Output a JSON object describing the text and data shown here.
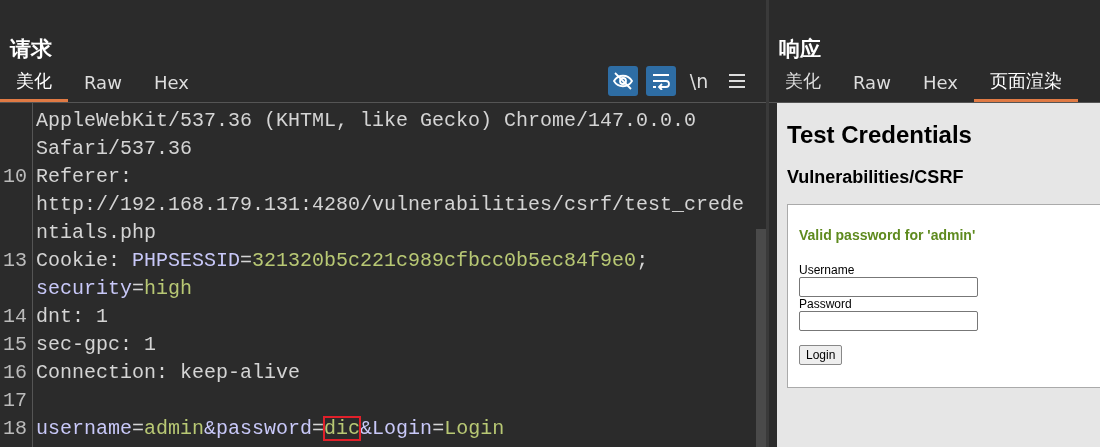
{
  "request": {
    "title": "请求",
    "tabs": [
      {
        "label": "美化",
        "selected": true
      },
      {
        "label": "Raw",
        "selected": false
      },
      {
        "label": "Hex",
        "selected": false
      }
    ],
    "toolbar": [
      {
        "kind": "eye-slash",
        "on": true
      },
      {
        "kind": "wrap",
        "on": true
      },
      {
        "kind": "text",
        "label": "\\n",
        "on": false
      },
      {
        "kind": "menu",
        "on": false
      }
    ],
    "lines": [
      {
        "tokens": [
          {
            "kind": "plain",
            "text": "AppleWebKit/537.36 (KHTML, like Gecko) Chrome/147.0.0.0"
          }
        ]
      },
      {
        "tokens": [
          {
            "kind": "plain",
            "text": "Safari/537.36"
          }
        ]
      },
      {
        "number": "10",
        "tokens": [
          {
            "kind": "plain",
            "text": "Referer:"
          }
        ]
      },
      {
        "tokens": [
          {
            "kind": "plain",
            "text": "http://192.168.179.131:4280/vulnerabilities/csrf/test_crede"
          }
        ]
      },
      {
        "tokens": [
          {
            "kind": "plain",
            "text": "ntials.php"
          }
        ]
      },
      {
        "number": "13",
        "tokens": [
          {
            "kind": "plain",
            "text": "Cookie: "
          },
          {
            "kind": "key",
            "text": "PHPSESSID"
          },
          {
            "kind": "plain",
            "text": "="
          },
          {
            "kind": "value",
            "text": "321320b5c221c989cfbcc0b5ec84f9e0"
          },
          {
            "kind": "plain",
            "text": ";"
          }
        ]
      },
      {
        "tokens": [
          {
            "kind": "key",
            "text": "security"
          },
          {
            "kind": "plain",
            "text": "="
          },
          {
            "kind": "value",
            "text": "high"
          }
        ]
      },
      {
        "number": "14",
        "tokens": [
          {
            "kind": "plain",
            "text": "dnt: 1"
          }
        ]
      },
      {
        "number": "15",
        "tokens": [
          {
            "kind": "plain",
            "text": "sec-gpc: 1"
          }
        ]
      },
      {
        "number": "16",
        "tokens": [
          {
            "kind": "plain",
            "text": "Connection: keep-alive"
          }
        ]
      },
      {
        "number": "17"
      },
      {
        "number": "18",
        "tokens": [
          {
            "kind": "key",
            "text": "username"
          },
          {
            "kind": "plain",
            "text": "="
          },
          {
            "kind": "value",
            "text": "admin"
          },
          {
            "kind": "key",
            "text": "&password"
          },
          {
            "kind": "plain",
            "text": "="
          },
          {
            "kind": "value",
            "text": "dic",
            "highlighted": true
          },
          {
            "kind": "key",
            "text": "&Login"
          },
          {
            "kind": "plain",
            "text": "="
          },
          {
            "kind": "value",
            "text": "Login"
          }
        ]
      }
    ]
  },
  "response": {
    "title": "响应",
    "tabs": [
      {
        "label": "美化",
        "selected": false
      },
      {
        "label": "Raw",
        "selected": false
      },
      {
        "label": "Hex",
        "selected": false
      },
      {
        "label": "页面渲染",
        "selected": true
      }
    ],
    "render": {
      "heading": "Test Credentials",
      "subheading": "Vulnerabilities/CSRF",
      "message": "Valid password for 'admin'",
      "fields": [
        {
          "label": "Username"
        },
        {
          "label": "Password"
        }
      ],
      "button": "Login"
    }
  }
}
